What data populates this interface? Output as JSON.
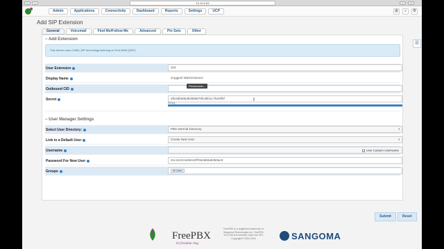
{
  "browser": {
    "url": "10.10.0.63"
  },
  "nav": {
    "items": [
      "Admin",
      "Applications",
      "Connectivity",
      "Dashboard",
      "Reports",
      "Settings",
      "UCP"
    ]
  },
  "page": {
    "title": "Add SIP Extension",
    "tabs": [
      "General",
      "Voicemail",
      "Find Me/Follow Me",
      "Advanced",
      "Pin Sets",
      "Other"
    ],
    "active_tab": "General"
  },
  "add_extension": {
    "section_title": "Add Extension",
    "info": "This device uses CHAN_SIP technology listening on Port 5060 (UDP)",
    "fields": {
      "user_extension": {
        "label": "User Extension",
        "value": "203"
      },
      "display_name": {
        "label": "Display Name",
        "value": "Jruggenl Wachminence"
      },
      "outbound_cid": {
        "label": "Outbound CID",
        "value": ""
      },
      "secret": {
        "label": "Secret",
        "value": "eftc9db995d83986879fcd5f4cc7be0ff4f",
        "strength": "Strong"
      }
    },
    "tooltip": "Placeholder..."
  },
  "user_manager": {
    "section_title": "User Manager Settings",
    "fields": {
      "select_user_directory": {
        "label": "Select User Directory:",
        "value": "PBX Internal Directory"
      },
      "link_default_user": {
        "label": "Link to a Default User",
        "value": "Create New User"
      },
      "username": {
        "label": "Username",
        "value": "",
        "checkbox_label": "Use Custom Username"
      },
      "password_new_user": {
        "label": "Password For New User",
        "value": "21c12c0c1e594c9f7b64d60ab360ac8"
      },
      "groups": {
        "label": "Groups",
        "tag": "All Users"
      }
    }
  },
  "actions": {
    "submit": "Submit",
    "reset": "Reset"
  },
  "footer": {
    "brand": "FreePBX",
    "tagline": "let freedom ring",
    "legal": "FreePBX is a registered trademark of Sangoma Technologies Inc. FreePBX 13.0.190.8 is licensed under the GPL Copyright© 2004-2016",
    "company": "SANGOMA"
  },
  "colors": {
    "accent": "#2b5c8a",
    "info_bg": "#d8ebf7",
    "row_alt": "#dbe9f5"
  }
}
